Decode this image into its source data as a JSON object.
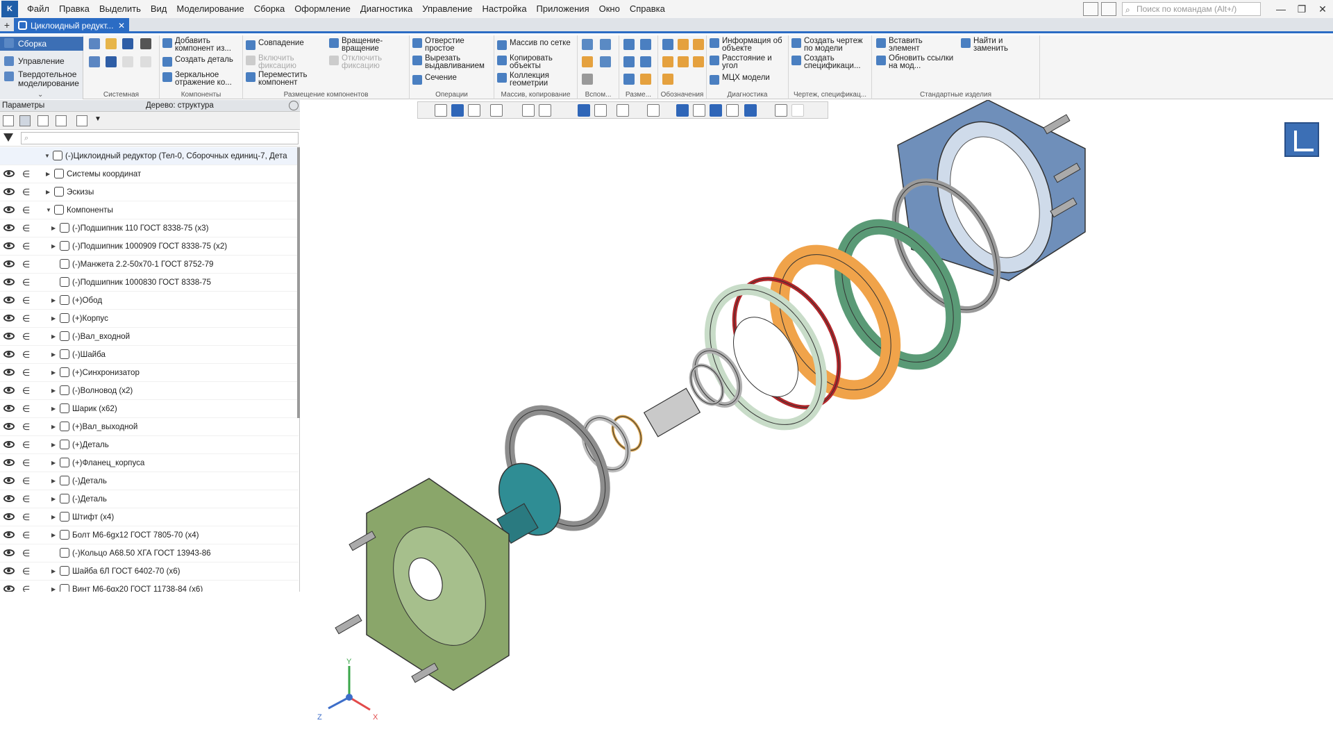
{
  "app": {
    "logo": "K"
  },
  "menu": [
    "Файл",
    "Правка",
    "Выделить",
    "Вид",
    "Моделирование",
    "Сборка",
    "Оформление",
    "Диагностика",
    "Управление",
    "Настройка",
    "Приложения",
    "Окно",
    "Справка"
  ],
  "search": {
    "placeholder": "Поиск по командам (Alt+/)"
  },
  "window_controls": {
    "minimize": "—",
    "restore": "❐",
    "close": "✕"
  },
  "tabs": {
    "add": "+",
    "document": "Циклоидный редукт...",
    "close": "✕"
  },
  "ribbon": {
    "left": {
      "assembly": "Сборка",
      "manage": "Управление",
      "solid": "Твердотельное моделирование",
      "expand": "⌄"
    },
    "groups": [
      {
        "label": "Системная"
      },
      {
        "label": "Компоненты",
        "buttons": [
          "Добавить компонент из...",
          "Создать деталь",
          "Зеркальное отражение ко..."
        ]
      },
      {
        "label": "Размещение компонентов",
        "buttons": [
          "Совпадение",
          "Включить фиксацию",
          "Переместить компонент",
          "Вращение-вращение",
          "Отключить фиксацию"
        ]
      },
      {
        "label": "Операции",
        "buttons": [
          "Отверстие простое",
          "Вырезать выдавливанием",
          "Сечение"
        ]
      },
      {
        "label": "Массив, копирование",
        "buttons": [
          "Массив по сетке",
          "Копировать объекты",
          "Коллекция геометрии"
        ]
      },
      {
        "label": "Вспом..."
      },
      {
        "label": "Разме..."
      },
      {
        "label": "Обозначения"
      },
      {
        "label": "Диагностика",
        "buttons": [
          "Информация об объекте",
          "Расстояние и угол",
          "МЦХ модели"
        ]
      },
      {
        "label": "Чертеж, спецификац...",
        "buttons": [
          "Создать чертеж по модели",
          "Создать спецификаци..."
        ]
      },
      {
        "label": "Стандартные изделия",
        "buttons": [
          "Вставить элемент",
          "Обновить ссылки на мод...",
          "Найти и заменить"
        ]
      }
    ]
  },
  "panel": {
    "title": "Параметры",
    "tree_mode": "Дерево: структура",
    "filter_placeholder": "⌕"
  },
  "tree": {
    "root": "(-)Циклоидный редуктор (Тел-0, Сборочных единиц-7, Дета",
    "items": [
      {
        "label": "Системы координат"
      },
      {
        "label": "Эскизы"
      },
      {
        "label": "Компоненты"
      },
      {
        "label": "(-)Подшипник 110 ГОСТ 8338-75 (x3)"
      },
      {
        "label": "(-)Подшипник 1000909 ГОСТ 8338-75 (x2)"
      },
      {
        "label": "(-)Манжета 2.2-50х70-1 ГОСТ 8752-79"
      },
      {
        "label": "(-)Подшипник 1000830 ГОСТ 8338-75"
      },
      {
        "label": "(+)Обод"
      },
      {
        "label": "(+)Корпус"
      },
      {
        "label": "(-)Вал_входной"
      },
      {
        "label": "(-)Шайба"
      },
      {
        "label": "(+)Синхронизатор"
      },
      {
        "label": "(-)Волновод (x2)"
      },
      {
        "label": "Шарик (x62)"
      },
      {
        "label": "(+)Вал_выходной"
      },
      {
        "label": "(+)Деталь"
      },
      {
        "label": "(+)Фланец_корпуса"
      },
      {
        "label": "(-)Деталь"
      },
      {
        "label": "(-)Деталь"
      },
      {
        "label": "Штифт (x4)"
      },
      {
        "label": "Болт М6-6gx12 ГОСТ 7805-70 (x4)"
      },
      {
        "label": "(-)Кольцо А68.50 ХГА ГОСТ 13943-86"
      },
      {
        "label": "Шайба 6Л ГОСТ 6402-70 (x6)"
      },
      {
        "label": "Винт М6-6gx20 ГОСТ 11738-84 (x6)"
      }
    ]
  },
  "axes": {
    "x": "X",
    "y": "Y",
    "z": "Z"
  },
  "colors": {
    "accent": "#2b6cc4",
    "housing": "#6f8fba",
    "flange": "#8aa66a",
    "wave": "#5a9a76",
    "orange": "#f0a34a",
    "red": "#b3262a",
    "teal": "#2f8d94"
  }
}
